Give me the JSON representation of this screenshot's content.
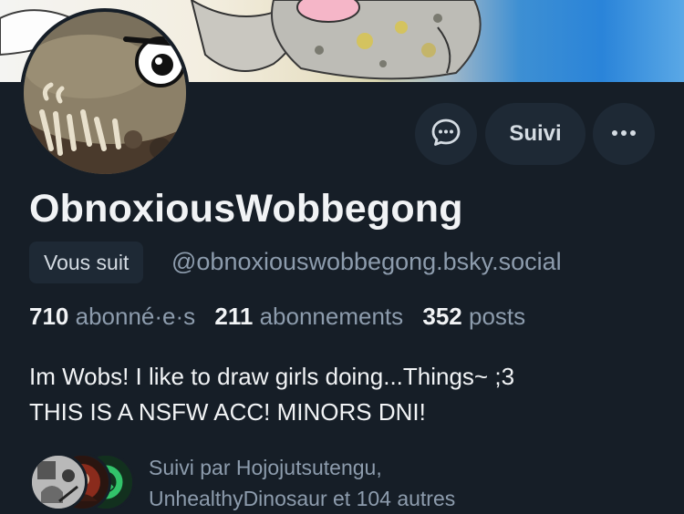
{
  "profile": {
    "display_name": "ObnoxiousWobbegong",
    "handle": "@obnoxiouswobbegong.bsky.social",
    "follows_you_badge": "Vous suit",
    "bio_line1": "Im Wobs!  I like to draw girls doing...Things~ ;3",
    "bio_line2": "THIS IS A NSFW ACC!  MINORS DNI!"
  },
  "actions": {
    "message_icon": "chat-bubble-icon",
    "follow_label": "Suivi",
    "more_icon": "ellipsis-icon"
  },
  "stats": {
    "followers_count": "710",
    "followers_label": "abonné·e·s",
    "following_count": "211",
    "following_label": "abonnements",
    "posts_count": "352",
    "posts_label": "posts"
  },
  "followed_by": {
    "line1": "Suivi par Hojojutsutengu,",
    "line2": "UnhealthyDinosaur et 104 autres"
  },
  "colors": {
    "background": "#161e27",
    "button_bg": "#1e2935",
    "text_primary": "#f1f3f5",
    "text_secondary": "#8d9cad"
  }
}
